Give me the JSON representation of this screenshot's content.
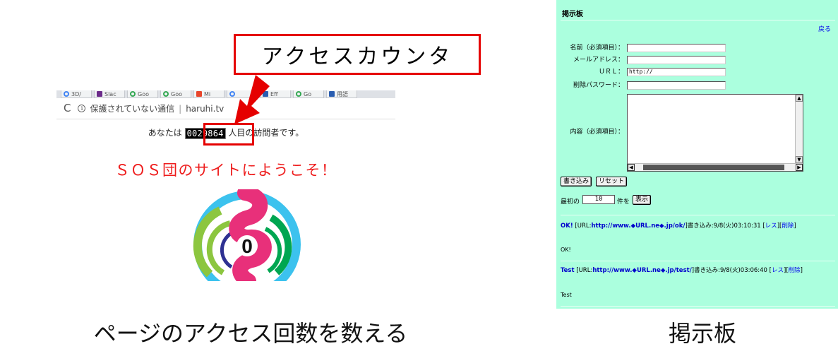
{
  "left": {
    "browser": {
      "tabs": [
        "3D/",
        "Slac",
        "Goo",
        "Goo",
        "Mi",
        "",
        "Eff",
        "Go",
        "用語"
      ],
      "address": {
        "security_label": "保護されていない通信",
        "url": "haruhi.tv"
      },
      "visit_prefix": "あなたは",
      "counter_value": "0029864",
      "visit_suffix": "人目の訪問者です。",
      "welcome": "ＳＯＳ団のサイトにようこそ！"
    },
    "callout": "アクセスカウンタ",
    "caption": "ページのアクセス回数を数える"
  },
  "right": {
    "bbs": {
      "title": "掲示板",
      "back_link": "戻る",
      "form": {
        "name_label": "名前（必須項目）：",
        "email_label": "メールアドレス：",
        "url_label": "ＵＲＬ：",
        "url_value": "http://",
        "delete_pw_label": "削除パスワード：",
        "content_label": "内容（必須項目）：",
        "submit_button": "書き込み",
        "reset_button": "リセット",
        "first_prefix": "最初の",
        "first_count": "10",
        "first_suffix": "件を",
        "show_button": "表示"
      },
      "posts": [
        {
          "title": "OK!",
          "url_prefix": "[URL:",
          "url": "http://www.◆URL.ne◆.jp/ok/",
          "meta": "]書き込み:9/8(火)03:10:31 [",
          "reply": "レス",
          "delete": "削除",
          "close": "]",
          "body": "OK!"
        },
        {
          "title": "Test",
          "url_prefix": "[URL:",
          "url": "http://www.◆URL.ne◆.jp/test/",
          "meta": "]書き込み:9/8(火)03:06:40 [",
          "reply": "レス",
          "delete": "削除",
          "close": "]",
          "body": "Test"
        }
      ]
    },
    "caption": "掲示板"
  },
  "colors": {
    "callout_red": "#e50000",
    "welcome_red": "#ee1c1c",
    "bbs_background": "#abffde",
    "link_blue": "#0000ee"
  }
}
